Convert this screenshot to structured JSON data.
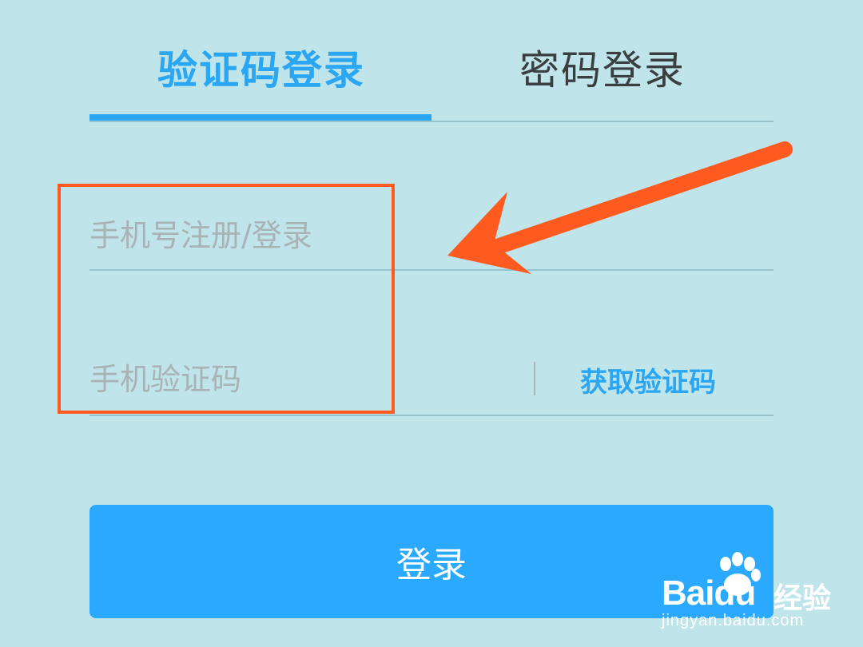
{
  "tabs": {
    "sms_login": "验证码登录",
    "password_login": "密码登录"
  },
  "form": {
    "phone_placeholder": "手机号注册/登录",
    "code_placeholder": "手机验证码",
    "get_code": "获取验证码",
    "login_button": "登录"
  },
  "watermark": {
    "brand": "Baidu",
    "suffix": "经验",
    "url": "jingyan.baidu.com"
  },
  "colors": {
    "background": "#bfe4ea",
    "accent": "#2aa6f2",
    "annotation": "#ff5a1f"
  },
  "annotation": {
    "highlight": "phone-and-code-fields",
    "arrow_icon": "arrow-left-icon"
  }
}
